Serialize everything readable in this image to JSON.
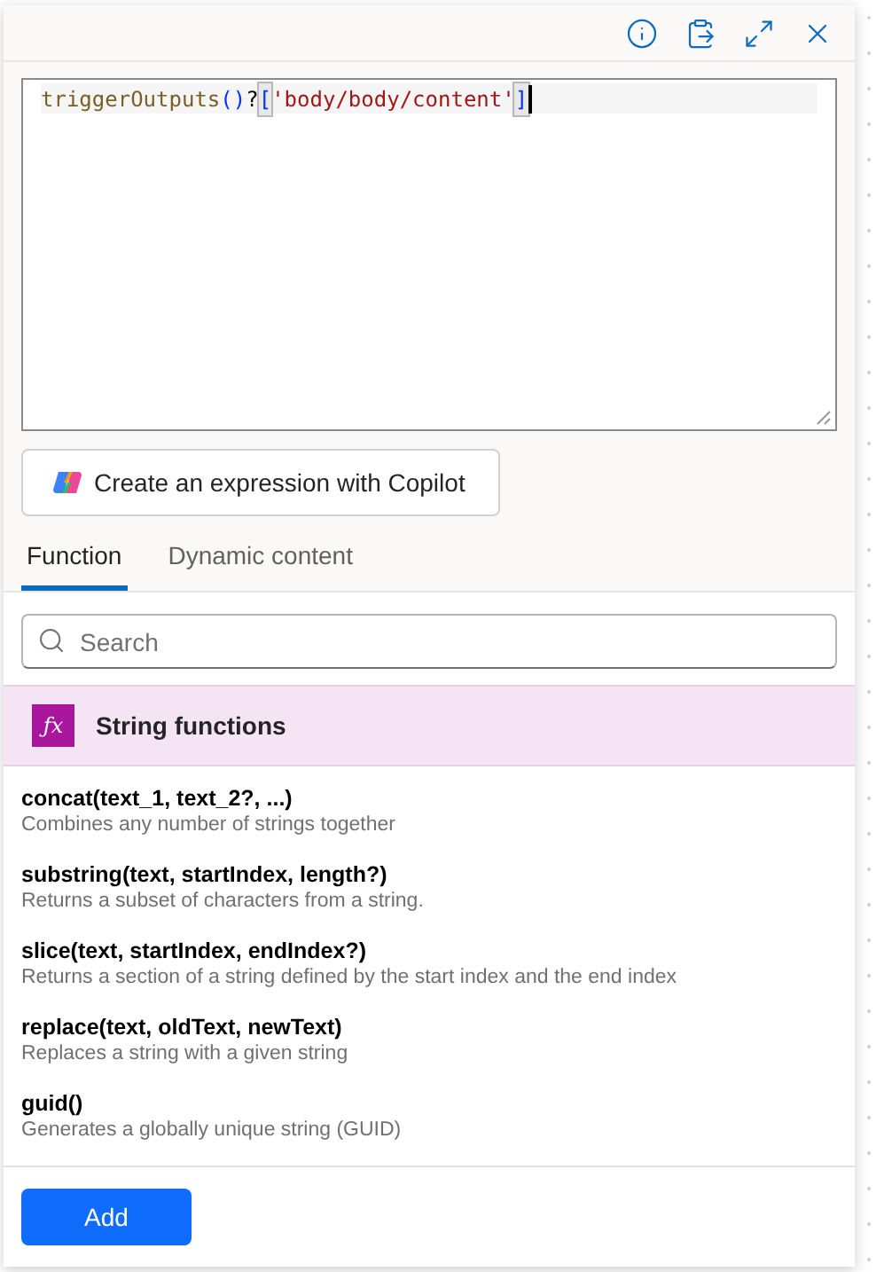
{
  "toolbar": {
    "buttons": [
      {
        "kind": "info"
      },
      {
        "kind": "paste"
      },
      {
        "kind": "expand"
      },
      {
        "kind": "close"
      }
    ]
  },
  "editor": {
    "tokens": [
      {
        "text": "triggerOutputs",
        "kind": "function"
      },
      {
        "text": "()",
        "kind": "paren"
      },
      {
        "text": "?",
        "kind": "operator"
      },
      {
        "text": "[",
        "kind": "bracket"
      },
      {
        "text": "'body/body/content'",
        "kind": "string"
      },
      {
        "text": "]",
        "kind": "bracket"
      }
    ]
  },
  "copilot_button": {
    "label": "Create an expression with Copilot"
  },
  "tabs": [
    {
      "label": "Function",
      "selected": true
    },
    {
      "label": "Dynamic content",
      "selected": false
    }
  ],
  "search": {
    "placeholder": "Search"
  },
  "category": {
    "icon": "ƒx",
    "title": "String functions"
  },
  "functions": [
    {
      "signature": "concat(text_1, text_2?, ...)",
      "description": "Combines any number of strings together"
    },
    {
      "signature": "substring(text, startIndex, length?)",
      "description": "Returns a subset of characters from a string."
    },
    {
      "signature": "slice(text, startIndex, endIndex?)",
      "description": "Returns a section of a string defined by the start index and the end index"
    },
    {
      "signature": "replace(text, oldText, newText)",
      "description": "Replaces a string with a given string"
    },
    {
      "signature": "guid()",
      "description": "Generates a globally unique string (GUID)"
    }
  ],
  "footer": {
    "button": "Add"
  }
}
